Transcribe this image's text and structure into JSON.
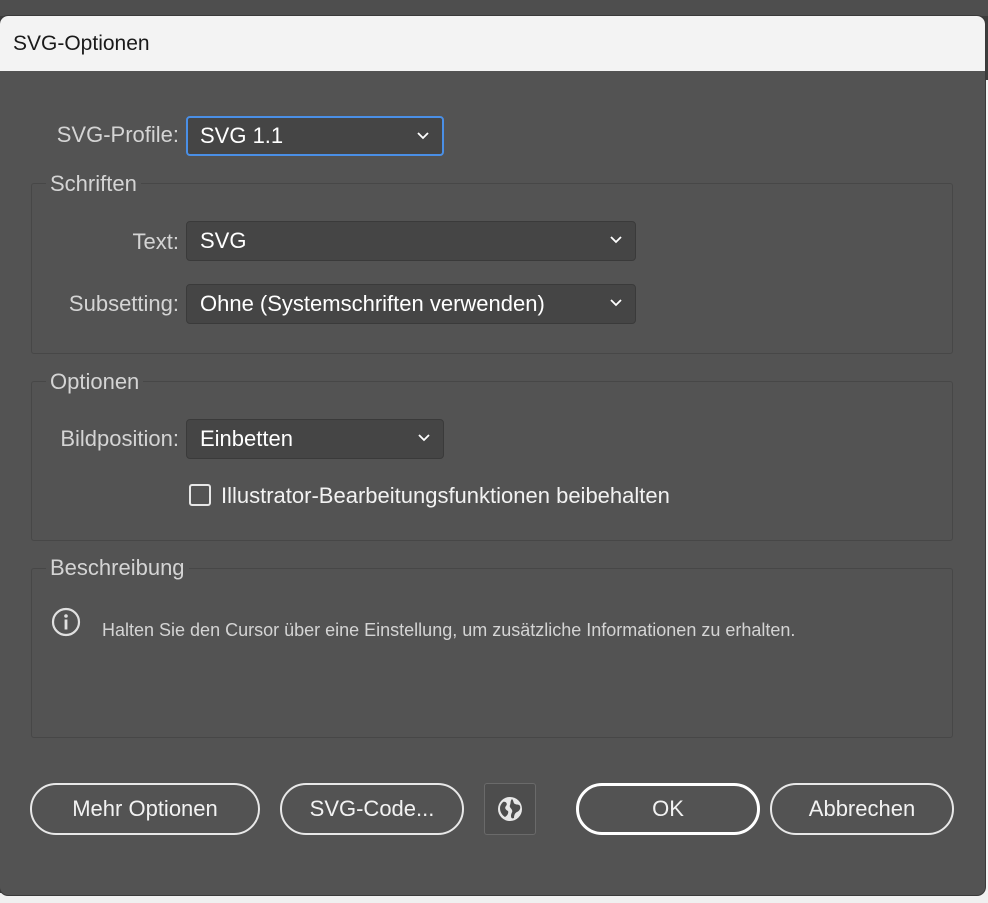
{
  "dialog": {
    "title": "SVG-Optionen"
  },
  "profile": {
    "label": "SVG-Profile:",
    "value": "SVG 1.1"
  },
  "fonts": {
    "group_title": "Schriften",
    "text_label": "Text:",
    "text_value": "SVG",
    "subsetting_label": "Subsetting:",
    "subsetting_value": "Ohne (Systemschriften verwenden)"
  },
  "options": {
    "group_title": "Optionen",
    "image_location_label": "Bildposition:",
    "image_location_value": "Einbetten",
    "preserve_editing_label": "Illustrator-Bearbeitungsfunktionen beibehalten",
    "preserve_editing_checked": false
  },
  "description": {
    "group_title": "Beschreibung",
    "text": "Halten Sie den Cursor über eine Einstellung, um zusätzliche Informationen zu erhalten."
  },
  "buttons": {
    "more_options": "Mehr Optionen",
    "svg_code": "SVG-Code...",
    "web_preview_icon": "globe-icon",
    "ok": "OK",
    "cancel": "Abbrechen"
  },
  "colors": {
    "dialog_bg": "#535353",
    "focus_ring": "#4a8fe6",
    "titlebar_bg": "#f3f3f3"
  }
}
